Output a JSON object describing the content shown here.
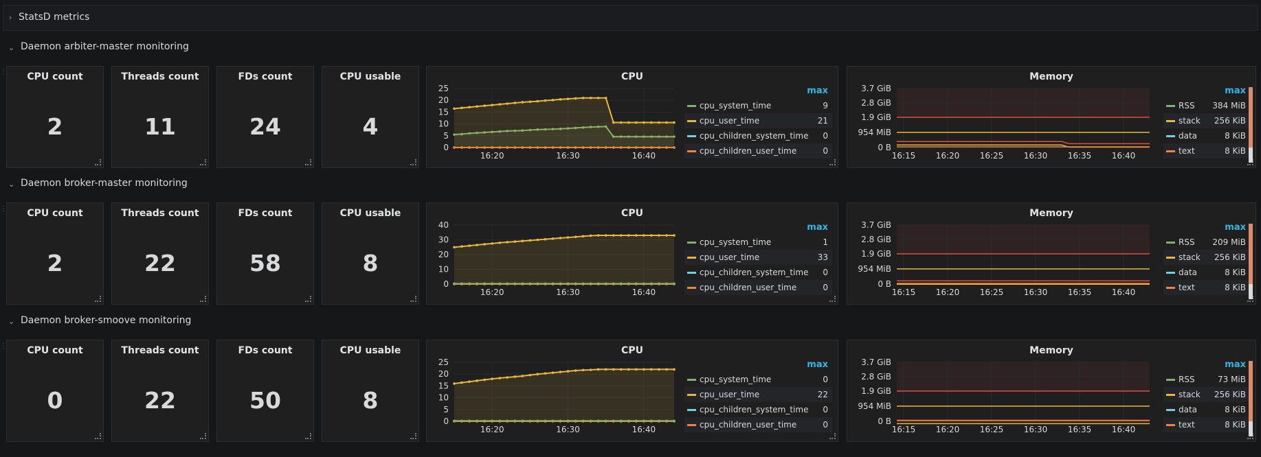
{
  "statsd": {
    "title": "StatsD metrics"
  },
  "daemons": [
    {
      "row_title": "Daemon arbiter-master monitoring",
      "stats": [
        {
          "title": "CPU count",
          "value": "2"
        },
        {
          "title": "Threads count",
          "value": "11"
        },
        {
          "title": "FDs count",
          "value": "24"
        },
        {
          "title": "CPU usable",
          "value": "4"
        }
      ],
      "cpu": {
        "title": "CPU",
        "yticks": [
          "25",
          "20",
          "15",
          "10",
          "5",
          "0"
        ],
        "ymax": 25,
        "xticks": [
          "16:20",
          "16:30",
          "16:40"
        ],
        "legend_header": "max",
        "legend": [
          {
            "name": "cpu_system_time",
            "max": "9"
          },
          {
            "name": "cpu_user_time",
            "max": "21"
          },
          {
            "name": "cpu_children_system_time",
            "max": "0"
          },
          {
            "name": "cpu_children_user_time",
            "max": "0"
          }
        ]
      },
      "memory": {
        "title": "Memory",
        "yticks": [
          "3.7 GiB",
          "2.8 GiB",
          "1.9 GiB",
          "954 MiB",
          "0 B"
        ],
        "xticks": [
          "16:15",
          "16:20",
          "16:25",
          "16:30",
          "16:35",
          "16:40"
        ],
        "legend_header": "max",
        "legend": [
          {
            "name": "RSS",
            "max": "384 MiB"
          },
          {
            "name": "stack",
            "max": "256 KiB"
          },
          {
            "name": "data",
            "max": "8 KiB"
          },
          {
            "name": "text",
            "max": "8 KiB"
          }
        ]
      }
    },
    {
      "row_title": "Daemon broker-master monitoring",
      "stats": [
        {
          "title": "CPU count",
          "value": "2"
        },
        {
          "title": "Threads count",
          "value": "22"
        },
        {
          "title": "FDs count",
          "value": "58"
        },
        {
          "title": "CPU usable",
          "value": "8"
        }
      ],
      "cpu": {
        "title": "CPU",
        "yticks": [
          "40",
          "30",
          "20",
          "10",
          "0"
        ],
        "ymax": 40,
        "xticks": [
          "16:20",
          "16:30",
          "16:40"
        ],
        "legend_header": "max",
        "legend": [
          {
            "name": "cpu_system_time",
            "max": "1"
          },
          {
            "name": "cpu_user_time",
            "max": "33"
          },
          {
            "name": "cpu_children_system_time",
            "max": "0"
          },
          {
            "name": "cpu_children_user_time",
            "max": "0"
          }
        ]
      },
      "memory": {
        "title": "Memory",
        "yticks": [
          "3.7 GiB",
          "2.8 GiB",
          "1.9 GiB",
          "954 MiB",
          "0 B"
        ],
        "xticks": [
          "16:15",
          "16:20",
          "16:25",
          "16:30",
          "16:35",
          "16:40"
        ],
        "legend_header": "max",
        "legend": [
          {
            "name": "RSS",
            "max": "209 MiB"
          },
          {
            "name": "stack",
            "max": "256 KiB"
          },
          {
            "name": "data",
            "max": "8 KiB"
          },
          {
            "name": "text",
            "max": "8 KiB"
          }
        ]
      }
    },
    {
      "row_title": "Daemon broker-smoove monitoring",
      "stats": [
        {
          "title": "CPU count",
          "value": "0"
        },
        {
          "title": "Threads count",
          "value": "22"
        },
        {
          "title": "FDs count",
          "value": "50"
        },
        {
          "title": "CPU usable",
          "value": "8"
        }
      ],
      "cpu": {
        "title": "CPU",
        "yticks": [
          "25",
          "20",
          "15",
          "10",
          "5",
          "0"
        ],
        "ymax": 25,
        "xticks": [
          "16:20",
          "16:30",
          "16:40"
        ],
        "legend_header": "max",
        "legend": [
          {
            "name": "cpu_system_time",
            "max": "0"
          },
          {
            "name": "cpu_user_time",
            "max": "22"
          },
          {
            "name": "cpu_children_system_time",
            "max": "0"
          },
          {
            "name": "cpu_children_user_time",
            "max": "0"
          }
        ]
      },
      "memory": {
        "title": "Memory",
        "yticks": [
          "3.7 GiB",
          "2.8 GiB",
          "1.9 GiB",
          "954 MiB",
          "0 B"
        ],
        "xticks": [
          "16:15",
          "16:20",
          "16:25",
          "16:30",
          "16:35",
          "16:40"
        ],
        "legend_header": "max",
        "legend": [
          {
            "name": "RSS",
            "max": "73 MiB"
          },
          {
            "name": "stack",
            "max": "256 KiB"
          },
          {
            "name": "data",
            "max": "8 KiB"
          },
          {
            "name": "text",
            "max": "8 KiB"
          }
        ]
      }
    }
  ],
  "colors": {
    "cpu_system_time": "#7eb26d",
    "cpu_user_time": "#eab839",
    "cpu_children_system_time": "#6ed0e0",
    "cpu_children_user_time": "#ef843c",
    "rss": "#7eb26d",
    "stack": "#eab839",
    "data": "#6ed0e0",
    "text": "#ef843c",
    "threshold": "#e24d42",
    "accent": "#33b5e5"
  },
  "chart_data": [
    {
      "type": "line",
      "title": "CPU",
      "x": [
        "16:15",
        "16:16",
        "16:17",
        "16:18",
        "16:19",
        "16:20",
        "16:21",
        "16:22",
        "16:23",
        "16:24",
        "16:25",
        "16:26",
        "16:27",
        "16:28",
        "16:29",
        "16:30",
        "16:31",
        "16:32",
        "16:33",
        "16:34",
        "16:35",
        "16:36",
        "16:37",
        "16:38",
        "16:39",
        "16:40",
        "16:41",
        "16:42",
        "16:43",
        "16:44"
      ],
      "ylim": [
        0,
        25
      ],
      "series": [
        {
          "name": "cpu_system_time",
          "values": [
            5.5,
            5.7,
            6,
            6.2,
            6.4,
            6.6,
            6.8,
            7,
            7.1,
            7.2,
            7.4,
            7.6,
            7.7,
            7.8,
            7.9,
            8.1,
            8.3,
            8.5,
            8.7,
            8.8,
            8.9,
            4.6,
            4.6,
            4.6,
            4.6,
            4.6,
            4.6,
            4.6,
            4.6,
            4.6
          ]
        },
        {
          "name": "cpu_user_time",
          "values": [
            16.5,
            16.8,
            17.1,
            17.4,
            17.7,
            18,
            18.3,
            18.6,
            18.9,
            19.2,
            19.4,
            19.6,
            19.9,
            20.1,
            20.4,
            20.6,
            20.8,
            21,
            21,
            21,
            21,
            10.6,
            10.6,
            10.6,
            10.6,
            10.6,
            10.6,
            10.6,
            10.6,
            10.6
          ]
        },
        {
          "name": "cpu_children_system_time",
          "values": [
            0,
            0,
            0,
            0,
            0,
            0,
            0,
            0,
            0,
            0,
            0,
            0,
            0,
            0,
            0,
            0,
            0,
            0,
            0,
            0,
            0,
            0,
            0,
            0,
            0,
            0,
            0,
            0,
            0,
            0
          ]
        },
        {
          "name": "cpu_children_user_time",
          "values": [
            0,
            0,
            0,
            0,
            0,
            0,
            0,
            0,
            0,
            0,
            0,
            0,
            0,
            0,
            0,
            0,
            0,
            0,
            0,
            0,
            0,
            0,
            0,
            0,
            0,
            0,
            0,
            0,
            0,
            0
          ]
        }
      ]
    },
    {
      "type": "line",
      "title": "Memory",
      "ylim_gib": [
        0,
        3.7
      ],
      "thresholds_gib": [
        1.9,
        0.954
      ],
      "series": [
        {
          "name": "RSS",
          "break_time": "16:33",
          "values_mib": [
            384,
            384,
            384,
            384,
            384,
            384,
            384,
            384,
            384,
            384,
            384,
            384,
            384,
            384,
            384,
            384,
            384,
            384,
            384,
            384,
            384,
            384,
            384,
            384,
            384,
            384,
            250,
            250,
            250,
            250
          ]
        },
        {
          "name": "stack",
          "values_kib": [
            256
          ]
        },
        {
          "name": "data",
          "values_kib": [
            8
          ]
        },
        {
          "name": "text",
          "values_kib": [
            8
          ]
        }
      ]
    },
    {
      "type": "line",
      "title": "CPU",
      "ylim": [
        0,
        40
      ],
      "series": [
        {
          "name": "cpu_system_time",
          "values": [
            0.3,
            0.3,
            0.3,
            0.3,
            0.3,
            0.3,
            0.3,
            0.3,
            0.3,
            0.3,
            0.3,
            0.3,
            0.3,
            0.3,
            0.3,
            0.3,
            0.3,
            0.3,
            0.3,
            0.3,
            0.3,
            0.3,
            0.3,
            0.3,
            0.3,
            0.3,
            0.3,
            0.3,
            0.3,
            0.3
          ]
        },
        {
          "name": "cpu_user_time",
          "values": [
            25,
            25.5,
            26,
            26.5,
            27,
            27.5,
            28,
            28.4,
            28.8,
            29.2,
            29.6,
            30,
            30.4,
            30.8,
            31.2,
            31.6,
            32,
            32.4,
            32.8,
            33,
            33,
            33,
            33,
            33,
            33,
            33,
            33,
            33,
            33,
            33
          ]
        },
        {
          "name": "cpu_children_system_time",
          "values": [
            0,
            0,
            0,
            0,
            0,
            0,
            0,
            0,
            0,
            0,
            0,
            0,
            0,
            0,
            0,
            0,
            0,
            0,
            0,
            0,
            0,
            0,
            0,
            0,
            0,
            0,
            0,
            0,
            0,
            0
          ]
        },
        {
          "name": "cpu_children_user_time",
          "values": [
            0,
            0,
            0,
            0,
            0,
            0,
            0,
            0,
            0,
            0,
            0,
            0,
            0,
            0,
            0,
            0,
            0,
            0,
            0,
            0,
            0,
            0,
            0,
            0,
            0,
            0,
            0,
            0,
            0,
            0
          ]
        }
      ]
    },
    {
      "type": "line",
      "title": "Memory",
      "ylim_gib": [
        0,
        3.7
      ],
      "series": [
        {
          "name": "RSS",
          "max_mib": 209
        },
        {
          "name": "stack",
          "max_kib": 256
        },
        {
          "name": "data",
          "max_kib": 8
        },
        {
          "name": "text",
          "max_kib": 8
        }
      ]
    },
    {
      "type": "line",
      "title": "CPU",
      "ylim": [
        0,
        25
      ],
      "series": [
        {
          "name": "cpu_system_time",
          "values": [
            0.2,
            0.2,
            0.2,
            0.2,
            0.2,
            0.2,
            0.2,
            0.2,
            0.2,
            0.2,
            0.2,
            0.2,
            0.2,
            0.2,
            0.2,
            0.2,
            0.2,
            0.2,
            0.2,
            0.2,
            0.2,
            0.2,
            0.2,
            0.2,
            0.2,
            0.2,
            0.2,
            0.2,
            0.2,
            0.2
          ]
        },
        {
          "name": "cpu_user_time",
          "values": [
            16,
            16.4,
            16.8,
            17.2,
            17.6,
            18,
            18.3,
            18.6,
            18.9,
            19.2,
            19.6,
            20,
            20.3,
            20.6,
            20.9,
            21.2,
            21.5,
            21.7,
            21.8,
            22,
            22,
            22,
            22,
            22,
            22,
            22,
            22,
            22,
            22,
            22
          ]
        },
        {
          "name": "cpu_children_system_time",
          "values": [
            0,
            0,
            0,
            0,
            0,
            0,
            0,
            0,
            0,
            0,
            0,
            0,
            0,
            0,
            0,
            0,
            0,
            0,
            0,
            0,
            0,
            0,
            0,
            0,
            0,
            0,
            0,
            0,
            0,
            0
          ]
        },
        {
          "name": "cpu_children_user_time",
          "values": [
            0,
            0,
            0,
            0,
            0,
            0,
            0,
            0,
            0,
            0,
            0,
            0,
            0,
            0,
            0,
            0,
            0,
            0,
            0,
            0,
            0,
            0,
            0,
            0,
            0,
            0,
            0,
            0,
            0,
            0
          ]
        }
      ]
    },
    {
      "type": "line",
      "title": "Memory",
      "ylim_gib": [
        0,
        3.7
      ],
      "series": [
        {
          "name": "RSS",
          "max_mib": 73
        },
        {
          "name": "stack",
          "max_kib": 256
        },
        {
          "name": "data",
          "max_kib": 8
        },
        {
          "name": "text",
          "max_kib": 8
        }
      ]
    }
  ]
}
